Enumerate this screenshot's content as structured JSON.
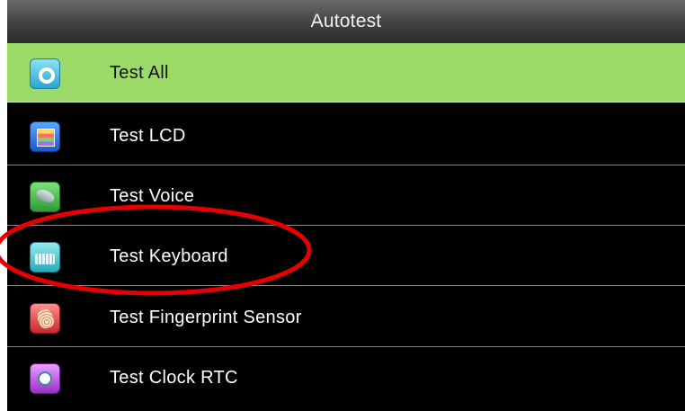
{
  "title": "Autotest",
  "menu": [
    {
      "label": "Test All",
      "icon": "test-all-icon"
    },
    {
      "label": "Test LCD",
      "icon": "lcd-icon"
    },
    {
      "label": "Test Voice",
      "icon": "speaker-icon"
    },
    {
      "label": "Test Keyboard",
      "icon": "keyboard-icon"
    },
    {
      "label": "Test Fingerprint Sensor",
      "icon": "fingerprint-icon"
    },
    {
      "label": "Test Clock RTC",
      "icon": "clock-icon"
    }
  ],
  "selected_index": 0,
  "highlight": {
    "target": "Test Keyboard",
    "shape": "ellipse",
    "color": "#e60000"
  }
}
